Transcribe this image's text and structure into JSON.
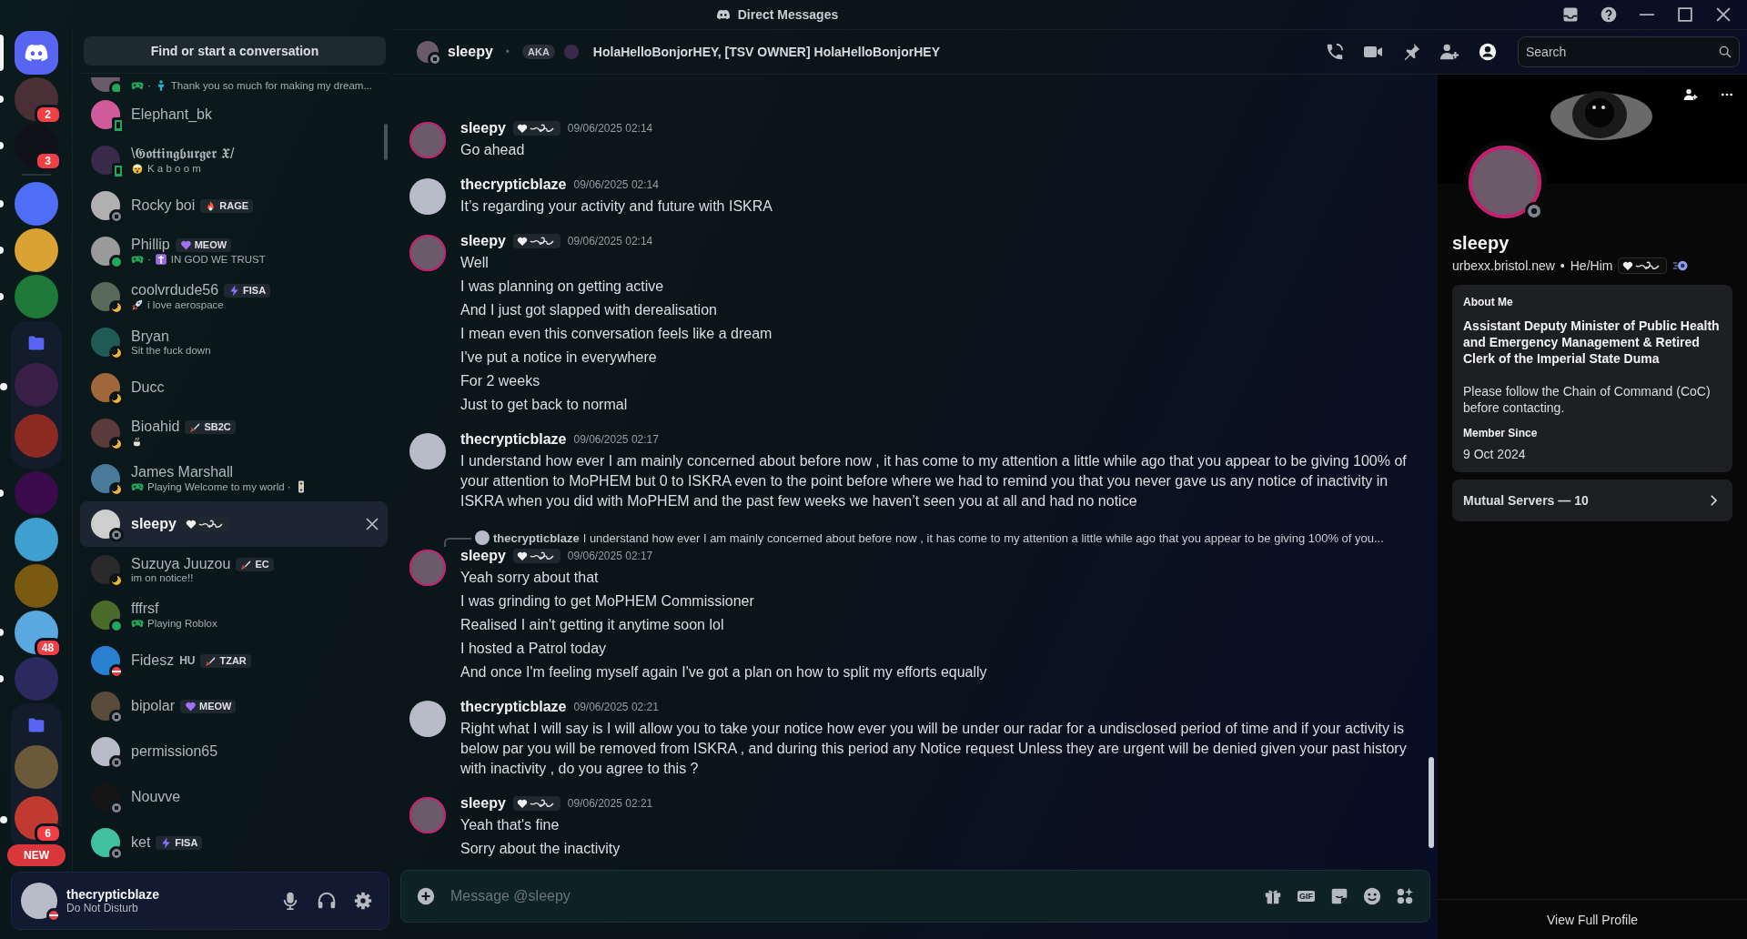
{
  "title_bar": {
    "title": "Direct Messages"
  },
  "server_rail": [
    {
      "kind": "home",
      "selected": true
    },
    {
      "kind": "server",
      "color": "#4a3036",
      "badge": "2",
      "unread": true,
      "selected": false
    },
    {
      "kind": "server",
      "color": "#101018",
      "badge": "3",
      "unread": true,
      "selected": false
    },
    {
      "kind": "separator"
    },
    {
      "kind": "server",
      "color": "#4f6ef7",
      "unread": true,
      "selected": false
    },
    {
      "kind": "server",
      "color": "#d9a233",
      "unread": true,
      "selected": false
    },
    {
      "kind": "server",
      "color": "#1f7a3a",
      "unread": true,
      "selected": false
    },
    {
      "kind": "folder",
      "children": [
        {
          "color": "#3a1f48",
          "unread": true
        },
        {
          "color": "#8a2a20"
        }
      ]
    },
    {
      "kind": "server",
      "color": "#3a0a4a",
      "unread": true,
      "selected": false
    },
    {
      "kind": "server",
      "color": "#3fa0d0",
      "selected": false
    },
    {
      "kind": "server",
      "color": "#7a5a10",
      "selected": false
    },
    {
      "kind": "server",
      "color": "#5aa8e0",
      "badge": "48",
      "unread": true,
      "selected": false
    },
    {
      "kind": "server",
      "color": "#2a2a60",
      "unread": true,
      "selected": false
    },
    {
      "kind": "folder",
      "children": [
        {
          "color": "#6a5a3a"
        },
        {
          "color": "#c03a30",
          "badge": "6",
          "unread": true
        }
      ]
    }
  ],
  "new_pill": "NEW",
  "dm_search": {
    "label": "Find or start a conversation"
  },
  "dms": [
    {
      "kind": "partial",
      "status": {
        "kind": "online"
      },
      "selected": false,
      "activity": [
        {
          "kind": "gamepad"
        },
        {
          "kind": "text",
          "text": "·"
        },
        {
          "kind": "figure"
        },
        {
          "kind": "text",
          "text": "Thank you so much for making my dream..."
        }
      ]
    },
    {
      "kind": "user",
      "name": "Elephant_bk",
      "status": {
        "kind": "mobile"
      },
      "selected": false
    },
    {
      "kind": "user",
      "name": "\\𝕲𝖔𝖙𝖙𝖎𝖓𝖌𝖇𝖚𝖗𝖌𝖊𝖗 𝖃/",
      "status": {
        "kind": "mobile"
      },
      "selected": false,
      "activity": [
        {
          "kind": "astonished"
        },
        {
          "kind": "text",
          "text": "K a b o o m"
        }
      ]
    },
    {
      "kind": "user",
      "name": "Rocky boi",
      "status": {
        "kind": "offline"
      },
      "selected": false,
      "tag": {
        "kind": "flame",
        "text": "RAGE"
      }
    },
    {
      "kind": "user",
      "name": "Phillip",
      "status": {
        "kind": "online"
      },
      "selected": false,
      "tag": {
        "kind": "heart",
        "text": "MEOW"
      },
      "activity": [
        {
          "kind": "gamepad"
        },
        {
          "kind": "text",
          "text": "·"
        },
        {
          "kind": "cross"
        },
        {
          "kind": "text",
          "text": "IN GOD WE TRUST"
        }
      ]
    },
    {
      "kind": "user",
      "name": "coolvrdude56",
      "status": {
        "kind": "idle"
      },
      "selected": false,
      "tag": {
        "kind": "bolt",
        "text": "FISA"
      },
      "activity": [
        {
          "kind": "rocket"
        },
        {
          "kind": "text",
          "text": "i love aerospace"
        }
      ]
    },
    {
      "kind": "user",
      "name": "Bryan",
      "status": {
        "kind": "idle"
      },
      "selected": false,
      "activity": [
        {
          "kind": "text",
          "text": "Sit the fuck down"
        }
      ]
    },
    {
      "kind": "user",
      "name": "Ducc",
      "status": {
        "kind": "idle"
      },
      "selected": false
    },
    {
      "kind": "user",
      "name": "Bioahid",
      "status": {
        "kind": "idle"
      },
      "selected": false,
      "tag": {
        "kind": "sword",
        "text": "SB2C"
      },
      "activity": [
        {
          "kind": "cup"
        }
      ]
    },
    {
      "kind": "user",
      "name": "James Marshall",
      "status": {
        "kind": "idle"
      },
      "selected": false,
      "activity": [
        {
          "kind": "gamepad"
        },
        {
          "kind": "text",
          "text": "Playing Welcome to my world ·"
        },
        {
          "kind": "traffic-light"
        }
      ]
    },
    {
      "kind": "user",
      "name": "sleepy",
      "status": {
        "kind": "offline"
      },
      "selected": true,
      "tag": {
        "kind": "ornament"
      }
    },
    {
      "kind": "user",
      "name": "Suzuya Juuzou",
      "status": {
        "kind": "idle"
      },
      "selected": false,
      "tag": {
        "kind": "sword",
        "text": "EC"
      },
      "activity": [
        {
          "kind": "text",
          "text": "im on notice!!"
        }
      ]
    },
    {
      "kind": "user",
      "name": "fffrsf",
      "status": {
        "kind": "online"
      },
      "selected": false,
      "activity": [
        {
          "kind": "gamepad"
        },
        {
          "kind": "text",
          "text": "Playing Roblox"
        }
      ]
    },
    {
      "kind": "user",
      "name": "Fidesz",
      "suffix": "HU",
      "status": {
        "kind": "dnd"
      },
      "selected": false,
      "tag": {
        "kind": "sword",
        "text": "TZAR"
      }
    },
    {
      "kind": "user",
      "name": "bipolar",
      "status": {
        "kind": "offline"
      },
      "selected": false,
      "tag": {
        "kind": "heart",
        "text": "MEOW"
      }
    },
    {
      "kind": "user",
      "name": "permission65",
      "status": {
        "kind": "offline"
      },
      "selected": false
    },
    {
      "kind": "user",
      "name": "Nouvve",
      "status": {
        "kind": "offline"
      },
      "selected": false
    },
    {
      "kind": "user",
      "name": "ket",
      "status": {
        "kind": "offline"
      },
      "selected": false,
      "tag": {
        "kind": "bolt",
        "text": "FISA"
      }
    }
  ],
  "current_user": {
    "name": "thecrypticblaze",
    "status_text": "Do Not Disturb",
    "status": {
      "kind": "dnd"
    }
  },
  "chat_header": {
    "name": "sleepy",
    "status": {
      "kind": "offline"
    },
    "separator": "•",
    "aka_label": "AKA",
    "aka_names": "HolaHelloBonjorHEY, [TSV OWNER] HolaHelloBonjorHEY",
    "search": {
      "placeholder": "Search"
    }
  },
  "messages": [
    {
      "author": "sleepy",
      "ring": true,
      "tag": true,
      "time": "09/06/2025 02:14",
      "lines": [
        "Go ahead"
      ]
    },
    {
      "author": "thecrypticblaze",
      "ring": false,
      "time": "09/06/2025 02:14",
      "lines": [
        "It’s regarding your activity and future with ISKRA"
      ]
    },
    {
      "author": "sleepy",
      "ring": true,
      "tag": true,
      "time": "09/06/2025 02:14",
      "lines": [
        "Well",
        "I was planning on getting active",
        "And I just got slapped with derealisation",
        "I mean even this conversation feels like a dream",
        "I've put a notice in everywhere",
        "For 2 weeks",
        "Just to get back to normal"
      ]
    },
    {
      "author": "thecrypticblaze",
      "ring": false,
      "time": "09/06/2025 02:17",
      "lines": [
        "I understand how ever I am mainly concerned about before now , it has come to my attention a little while ago that you appear to be giving 100% of your attention to MoPHEM but 0 to ISKRA even to the point before where we had to remind you that you never gave us any notice of inactivity  in ISKRA when you did with MoPHEM and the past few weeks we haven’t seen you at all and had no notice"
      ]
    },
    {
      "reply": {
        "author": "thecrypticblaze",
        "text": "I understand how ever I am mainly concerned about before now , it has come to my attention a little while ago that you appear to be giving 100% of you..."
      },
      "author": "sleepy",
      "ring": true,
      "tag": true,
      "time": "09/06/2025 02:17",
      "lines": [
        "Yeah sorry about that",
        "I was grinding to get MoPHEM Commissioner",
        "Realised I ain't getting it anytime soon lol",
        "I hosted a Patrol today",
        "And once I'm feeling myself again I've got a plan on how to split my efforts equally"
      ]
    },
    {
      "author": "thecrypticblaze",
      "ring": false,
      "time": "09/06/2025 02:21",
      "lines": [
        "Right what I will say is I will allow you to take your notice how ever you will be under our radar for a undisclosed period of time and if your activity is below par you will be removed from ISKRA , and during this period any Notice request Unless they are urgent will be denied given your past history with inactivity , do you agree to this ?"
      ]
    },
    {
      "author": "sleepy",
      "ring": true,
      "tag": true,
      "time": "09/06/2025 02:21",
      "lines": [
        "Yeah that's fine",
        "Sorry about the inactivity"
      ]
    }
  ],
  "composer": {
    "placeholder": "Message @sleepy",
    "gif_label": "GIF"
  },
  "profile": {
    "name": "sleepy",
    "status": {
      "kind": "offline"
    },
    "handle": "urbexx.bristol.new",
    "separator": "•",
    "pronouns": "He/Him",
    "about_heading": "About Me",
    "bio_bold": "Assistant Deputy Minister of Public Health and Emergency Management & Retired Clerk of the Imperial State Duma",
    "bio": "Please follow the Chain of Command (CoC) before contacting.",
    "member_since_heading": "Member Since",
    "member_since": "9 Oct 2024",
    "mutual_servers": "Mutual Servers — 10",
    "footer": "View Full Profile"
  }
}
